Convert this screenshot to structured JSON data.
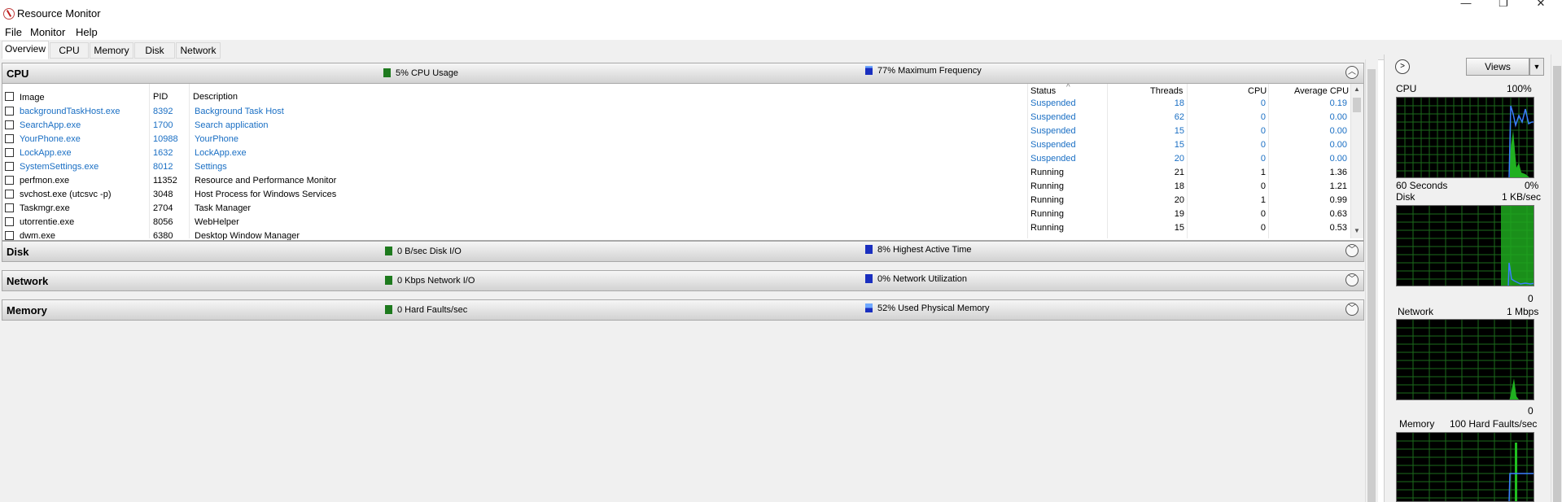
{
  "window": {
    "title": "Resource Monitor",
    "controls": {
      "minimize": "—",
      "restore": "❐",
      "close": "✕"
    }
  },
  "menu": [
    "File",
    "Monitor",
    "Help"
  ],
  "tabs": [
    "Overview",
    "CPU",
    "Memory",
    "Disk",
    "Network"
  ],
  "active_tab": "Overview",
  "colors": {
    "green_metric": "#1e7a1e",
    "blue_metric": "#1a2fbf",
    "link_blue": "#1a6fc4",
    "graph_green": "#2fcf2f",
    "graph_blue": "#3a7fff"
  },
  "sections": {
    "cpu": {
      "title": "CPU",
      "metric1": "5% CPU Usage",
      "metric2": "77% Maximum Frequency",
      "state": "expanded"
    },
    "disk": {
      "title": "Disk",
      "metric1": "0 B/sec Disk I/O",
      "metric2": "8% Highest Active Time",
      "state": "collapsed"
    },
    "network": {
      "title": "Network",
      "metric1": "0 Kbps Network I/O",
      "metric2": "0% Network Utilization",
      "state": "collapsed"
    },
    "memory": {
      "title": "Memory",
      "metric1": "0 Hard Faults/sec",
      "metric2": "52% Used Physical Memory",
      "state": "collapsed"
    }
  },
  "cpu_table": {
    "columns": {
      "image": "Image",
      "pid": "PID",
      "description": "Description",
      "status": "Status",
      "threads": "Threads",
      "cpu": "CPU",
      "avg_cpu": "Average CPU"
    },
    "rows": [
      {
        "image": "backgroundTaskHost.exe",
        "pid": "8392",
        "description": "Background Task Host",
        "status": "Suspended",
        "threads": "18",
        "cpu": "0",
        "avg_cpu": "0.19",
        "suspended": true
      },
      {
        "image": "SearchApp.exe",
        "pid": "1700",
        "description": "Search application",
        "status": "Suspended",
        "threads": "62",
        "cpu": "0",
        "avg_cpu": "0.00",
        "suspended": true
      },
      {
        "image": "YourPhone.exe",
        "pid": "10988",
        "description": "YourPhone",
        "status": "Suspended",
        "threads": "15",
        "cpu": "0",
        "avg_cpu": "0.00",
        "suspended": true
      },
      {
        "image": "LockApp.exe",
        "pid": "1632",
        "description": "LockApp.exe",
        "status": "Suspended",
        "threads": "15",
        "cpu": "0",
        "avg_cpu": "0.00",
        "suspended": true
      },
      {
        "image": "SystemSettings.exe",
        "pid": "8012",
        "description": "Settings",
        "status": "Suspended",
        "threads": "20",
        "cpu": "0",
        "avg_cpu": "0.00",
        "suspended": true
      },
      {
        "image": "perfmon.exe",
        "pid": "11352",
        "description": "Resource and Performance Monitor",
        "status": "Running",
        "threads": "21",
        "cpu": "1",
        "avg_cpu": "1.36",
        "suspended": false
      },
      {
        "image": "svchost.exe (utcsvc -p)",
        "pid": "3048",
        "description": "Host Process for Windows Services",
        "status": "Running",
        "threads": "18",
        "cpu": "0",
        "avg_cpu": "1.21",
        "suspended": false
      },
      {
        "image": "Taskmgr.exe",
        "pid": "2704",
        "description": "Task Manager",
        "status": "Running",
        "threads": "20",
        "cpu": "1",
        "avg_cpu": "0.99",
        "suspended": false
      },
      {
        "image": "utorrentie.exe",
        "pid": "8056",
        "description": "WebHelper",
        "status": "Running",
        "threads": "19",
        "cpu": "0",
        "avg_cpu": "0.63",
        "suspended": false
      },
      {
        "image": "dwm.exe",
        "pid": "6380",
        "description": "Desktop Window Manager",
        "status": "Running",
        "threads": "15",
        "cpu": "0",
        "avg_cpu": "0.53",
        "suspended": false
      }
    ]
  },
  "side": {
    "views_label": "Views",
    "graphs": [
      {
        "title": "CPU",
        "max": "100%",
        "footer_left": "60 Seconds",
        "footer_right": "0%",
        "icon": "cpu-graph"
      },
      {
        "title": "Disk",
        "max": "1 KB/sec",
        "footer_left": "",
        "footer_right": "0",
        "icon": "disk-graph"
      },
      {
        "title": "Network",
        "max": "1 Mbps",
        "footer_left": "",
        "footer_right": "0",
        "icon": "network-graph"
      },
      {
        "title": "Memory",
        "max": "100 Hard Faults/sec",
        "footer_left": "",
        "footer_right": "",
        "icon": "memory-graph"
      }
    ]
  }
}
